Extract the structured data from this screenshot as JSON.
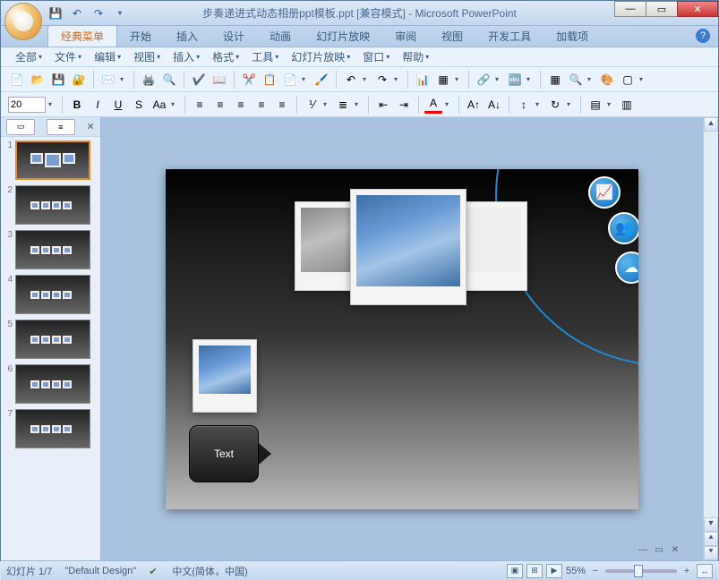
{
  "title": "步奏递进式动态相册ppt模板.ppt [兼容模式] - Microsoft PowerPoint",
  "ribbon_tabs": [
    "经典菜单",
    "开始",
    "插入",
    "设计",
    "动画",
    "幻灯片放映",
    "审阅",
    "视图",
    "开发工具",
    "加载项"
  ],
  "active_tab_index": 0,
  "menus": [
    "全部",
    "文件",
    "编辑",
    "视图",
    "插入",
    "格式",
    "工具",
    "幻灯片放映",
    "窗口",
    "帮助"
  ],
  "font_size": "20",
  "slide_text_label": "Text",
  "status": {
    "slide_counter": "幻灯片 1/7",
    "theme": "\"Default Design\"",
    "language": "中文(简体，中国)",
    "zoom": "55%"
  },
  "thumbnails": [
    1,
    2,
    3,
    4,
    5,
    6,
    7
  ],
  "active_thumb": 1
}
